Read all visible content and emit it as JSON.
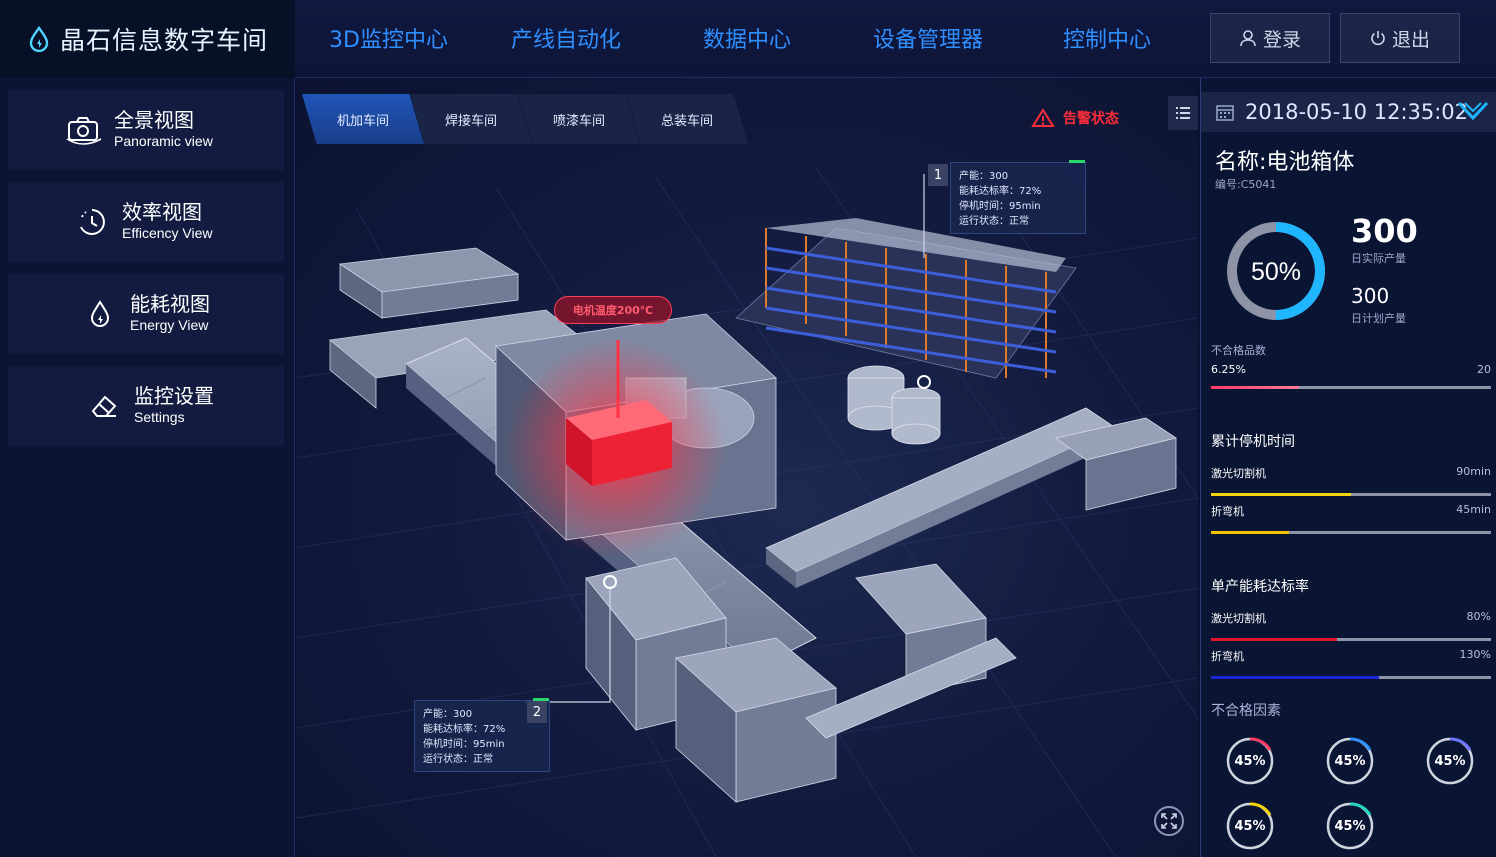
{
  "header": {
    "logo_title": "晶石信息数字车间",
    "nav": [
      "3D监控中心",
      "产线自动化",
      "数据中心",
      "设备管理器",
      "控制中心"
    ],
    "login_label": "登录",
    "logout_label": "退出",
    "nav_color": "#2f8fff"
  },
  "sidebar": {
    "items": [
      {
        "cn": "全景视图",
        "en": "Panoramic view",
        "icon": "camera-icon"
      },
      {
        "cn": "效率视图",
        "en": "Efficency View",
        "icon": "clock-icon"
      },
      {
        "cn": "能耗视图",
        "en": "Energy View",
        "icon": "drop-icon"
      },
      {
        "cn": "监控设置",
        "en": "Settings",
        "icon": "eraser-icon"
      }
    ]
  },
  "viewport": {
    "tabs": [
      "机加车间",
      "焊接车间",
      "喷漆车间",
      "总装车间"
    ],
    "alarm_label": "告警状态",
    "temp_label": "电机温度200℃",
    "cards": [
      {
        "badge": "1",
        "lines": [
          "产能：300",
          "能耗达标率：72%",
          "停机时间：95min",
          "运行状态：正常"
        ]
      },
      {
        "badge": "2",
        "lines": [
          "产能：300",
          "能耗达标率：72%",
          "停机时间：95min",
          "运行状态：正常"
        ]
      }
    ]
  },
  "right_panel": {
    "datetime": "2018-05-10 12:35:02",
    "name": "名称:电池箱体",
    "code": "编号:C5041",
    "donut_percent": "50%",
    "donut_fraction": 0.5,
    "actual_output": "300",
    "actual_output_label": "日实际产量",
    "plan_output": "300",
    "plan_output_label": "日计划产量",
    "defect_count_label": "不合格品数",
    "defect_percent": "6.25%",
    "defect_count": "20",
    "defect_fraction": 0.3125,
    "downtime_title": "累计停机时间",
    "downtime": [
      {
        "name": "激光切割机",
        "value": "90min",
        "fraction": 0.5,
        "color": "#f2d400"
      },
      {
        "name": "折弯机",
        "value": "45min",
        "fraction": 0.28,
        "color": "#f2c200"
      }
    ],
    "energy_title": "单产能耗达标率",
    "energy": [
      {
        "name": "激光切割机",
        "value": "80%",
        "fraction": 0.45,
        "color": "#e0142c"
      },
      {
        "name": "折弯机",
        "value": "130%",
        "fraction": 0.6,
        "color": "#1a26d8"
      }
    ],
    "factors_title": "不合格因素",
    "factors": [
      {
        "value": "45%",
        "color": "#ff3a66"
      },
      {
        "value": "45%",
        "color": "#2f8fff"
      },
      {
        "value": "45%",
        "color": "#6b74ff"
      },
      {
        "value": "45%",
        "color": "#f2d400"
      },
      {
        "value": "45%",
        "color": "#22d6c4"
      }
    ]
  }
}
